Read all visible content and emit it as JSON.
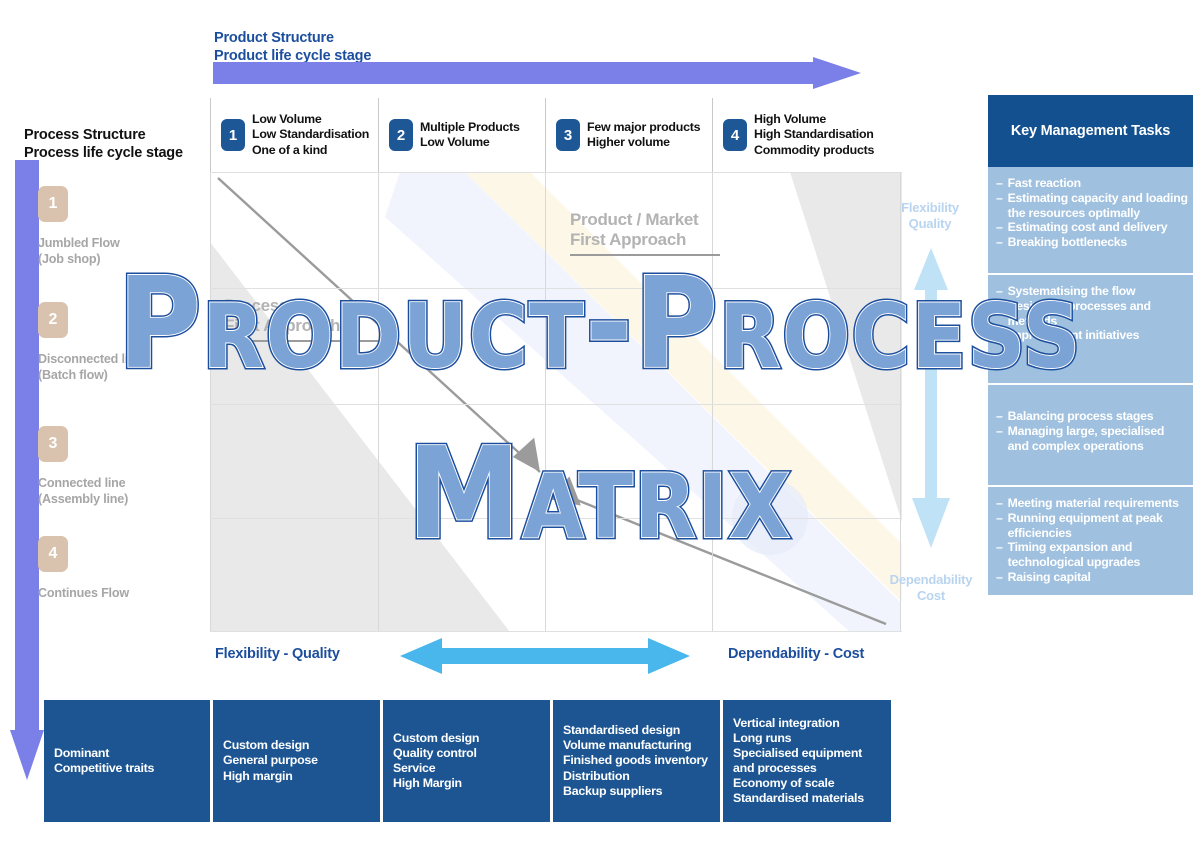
{
  "axes": {
    "product_title_line1": "Product Structure",
    "product_title_line2": "Product life cycle stage",
    "process_title_line1": "Process Structure",
    "process_title_line2": "Process life cycle stage",
    "bottom_left_label": "Flexibility - Quality",
    "bottom_right_label": "Dependability - Cost",
    "right_top_line1": "Flexibility",
    "right_top_line2": "Quality",
    "right_bottom_line1": "Dependability",
    "right_bottom_line2": "Cost"
  },
  "columns": [
    {
      "num": "1",
      "lines": [
        "Low Volume",
        "Low Standardisation",
        "One of a kind"
      ]
    },
    {
      "num": "2",
      "lines": [
        "Multiple Products",
        "Low Volume"
      ]
    },
    {
      "num": "3",
      "lines": [
        "Few major products",
        "Higher volume"
      ]
    },
    {
      "num": "4",
      "lines": [
        "High Volume",
        "High Standardisation",
        "Commodity products"
      ]
    }
  ],
  "rows": [
    {
      "num": "1",
      "lines": [
        "Jumbled Flow",
        "(Job shop)"
      ]
    },
    {
      "num": "2",
      "lines": [
        "Disconnected line",
        "(Batch flow)"
      ]
    },
    {
      "num": "3",
      "lines": [
        "Connected line",
        "(Assembly line)"
      ]
    },
    {
      "num": "4",
      "lines": [
        "Continues Flow"
      ]
    }
  ],
  "diagonal_labels": {
    "product_market_line1": "Product / Market",
    "product_market_line2": "First Approach",
    "process_line1": "Process",
    "process_line2": "First Approach"
  },
  "key_management": {
    "title": "Key Management Tasks",
    "blocks": [
      {
        "items": [
          "Fast reaction",
          "Estimating capacity and loading the resources optimally",
          "Estimating cost and delivery",
          "Breaking bottlenecks"
        ]
      },
      {
        "items": [
          "Systematising the flow",
          "Designing processes and methods",
          "Improvement initiatives"
        ]
      },
      {
        "items": [
          "Balancing process stages",
          "Managing large, specialised and complex operations"
        ]
      },
      {
        "items": [
          "Meeting material requirements",
          "Running equipment at peak efficiencies",
          "Timing expansion and technological upgrades",
          "Raising capital"
        ]
      }
    ],
    "dash": "–"
  },
  "traits": [
    {
      "lines": [
        "Dominant",
        "Competitive traits"
      ]
    },
    {
      "lines": [
        "Custom design",
        "General purpose",
        "High margin"
      ]
    },
    {
      "lines": [
        "Custom design",
        "Quality control",
        "Service",
        "High Margin"
      ]
    },
    {
      "lines": [
        "Standardised design",
        "Volume manufacturing",
        "Finished goods inventory",
        "Distribution",
        "Backup suppliers"
      ]
    },
    {
      "lines": [
        "Vertical integration",
        "Long runs",
        "Specialised equipment",
        "and processes",
        "Economy of scale",
        "Standardised materials"
      ]
    }
  ],
  "watermark": {
    "line1": "Product-Process",
    "line2": "Matrix"
  },
  "colors": {
    "brand_blue": "#1c4e9e",
    "panel_blue": "#13508f",
    "trait_blue": "#1c5592",
    "light_blue": "#9fc0de",
    "purple_arrow": "#7b7fe8",
    "cyan_arrow": "#49b6ec",
    "badge_blue": "#1e5796",
    "badge_tan": "#d9c2ae"
  }
}
